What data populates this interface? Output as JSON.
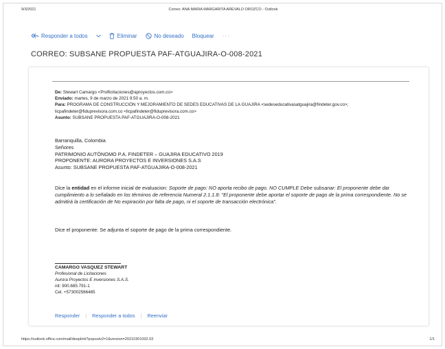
{
  "print_header": {
    "date": "9/3/2021",
    "title": "Correo: ANA MARIA MARGARITA AREVALO OROZCO - Outlook"
  },
  "toolbar": {
    "reply_all": "Responder a todos",
    "delete": "Eliminar",
    "junk": "No deseado",
    "block": "Bloquear",
    "more": "···"
  },
  "subject": "CORREO: SUBSANE PROPUESTA PAF-ATGUAJIRA-O-008-2021",
  "meta": {
    "from_label": "De:",
    "from_value": "Stewart Camargo <Proflicitaciones@aproyectos.com.co>",
    "sent_label": "Enviado:",
    "sent_value": "martes, 9 de marzo de 2021 9:50 a. m.",
    "to_label": "Para:",
    "to_value": "PROGRAMA DE CONSTRUCCIÓN Y MEJORAMIENTO DE SEDES EDUCATIVAS DE LA GUAJIRA <sedeseducativasatguajira@findeter.gov.co>; licpafindeter@fiduprevisora.com.co <licpafindeter@fiduprevisora.com.co>",
    "subject_label": "Asunto:",
    "subject_value": "SUBSANE PROPUESTA PAF-ATGUAJIRA-O-008-2021"
  },
  "body": {
    "address_lines": [
      "Barranquilla, Colombia",
      "Señores",
      "PATRIMONIO AUTÓNOMO P.A. FINDETER – GUAJIRA EDUCATIVO 2019",
      "PROPONENTE: AURORA PROYECTOS E INVERSIONES S.A.S",
      "Asunto: SUBSANE PROPUESTA PAF-ATGUAJIRA-O-008-2021"
    ],
    "para1_prefix": "Dice la ",
    "para1_bold": "entidad",
    "para1_mid": " en el informe inicial de evaluacion: ",
    "para1_italic": "Soporte de pago: NO aporta recibo de pago. NO CUMPLE Debe subsanar: El proponente debe dar cumplimiento a lo señalado en los términos de referencia Numeral 2.1.1.8: \"El proponente debe aportar el soporte de pago de la prima correspondiente. No se admitirá la certificación de No expiración por falta de pago, ni el soporte de transacción electrónica\".",
    "para2": "Dice el proponente: Se adjunta el soporte de pago de la prima correspondiente."
  },
  "signature": {
    "name": "CAMARGO VASQUEZ STEWART",
    "role": "Profesional de Licitaciones",
    "company": "Aurora Proyectos E inversiones S.A.S.",
    "nit": "nit: 900.685.791-1",
    "phone": "Cel. +573002566485"
  },
  "actions": {
    "reply": "Responder",
    "reply_all": "Responder a todos",
    "forward": "Reenviar"
  },
  "print_footer": {
    "url": "https://outlook.office.com/mail/deeplink?popoutv2=1&version=20210301002.03",
    "page": "1/1"
  },
  "colors": {
    "accent": "#2f6fc5"
  }
}
